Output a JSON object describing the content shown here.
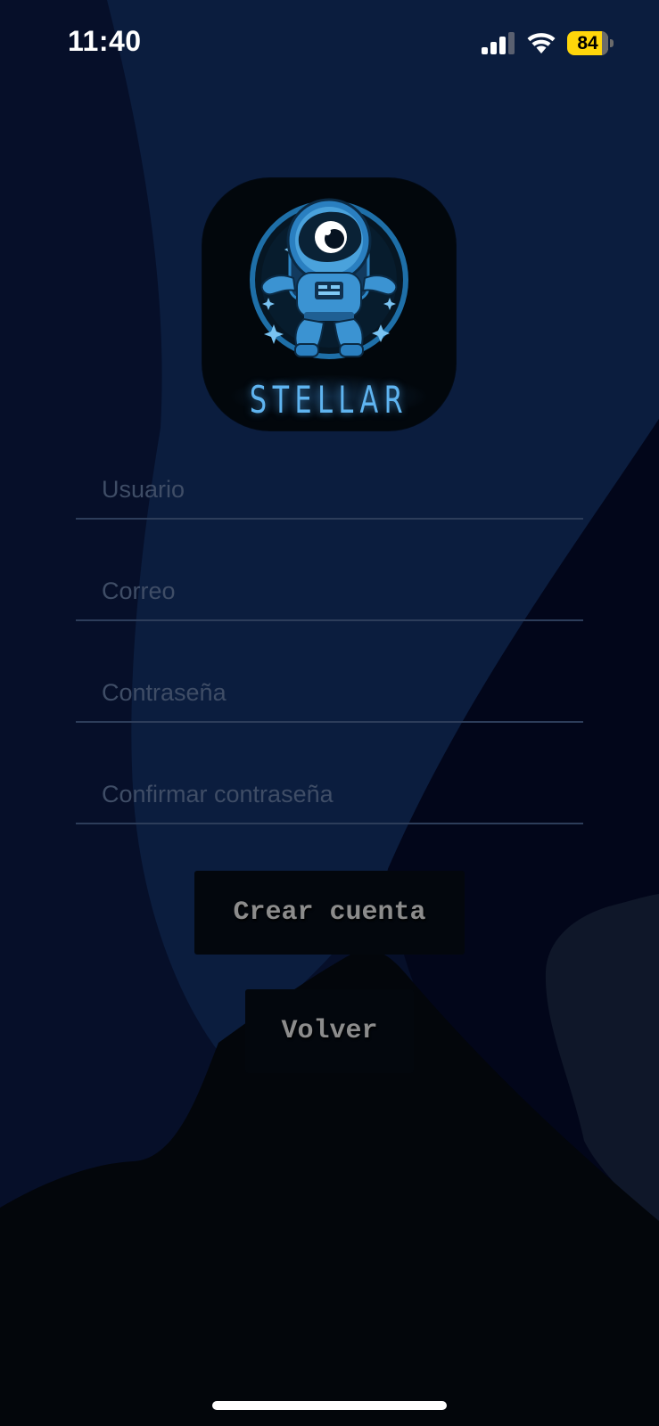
{
  "status_bar": {
    "time": "11:40",
    "battery_percent": "84",
    "battery_level": 0.84
  },
  "logo": {
    "text": "STELLAR"
  },
  "form": {
    "fields": [
      {
        "placeholder": "Usuario",
        "value": ""
      },
      {
        "placeholder": "Correo",
        "value": ""
      },
      {
        "placeholder": "Contraseña",
        "value": ""
      },
      {
        "placeholder": "Confirmar contraseña",
        "value": ""
      }
    ]
  },
  "buttons": {
    "create_label": "Crear cuenta",
    "back_label": "Volver"
  },
  "colors": {
    "background": "#060f29",
    "light_wave": "#0b1d3e",
    "mountain": "#03060b",
    "logo_text": "#5fb4f0",
    "battery": "#ffd60a",
    "button_text": "#8c8c8c"
  },
  "icons": [
    "signal-icon",
    "wifi-icon",
    "battery-icon",
    "astronaut-icon"
  ]
}
